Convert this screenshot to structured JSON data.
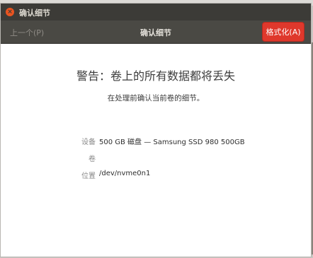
{
  "window": {
    "title": "确认细节",
    "close_icon": "close-icon"
  },
  "header": {
    "prev_label": "上一个(P)",
    "title": "确认细节",
    "format_label": "格式化(A)",
    "format_color": "#df382c"
  },
  "content": {
    "warning_title": "警告：卷上的所有数据都将丢失",
    "warning_subtitle": "在处理前确认当前卷的细节。",
    "details": [
      {
        "label": "设备",
        "value": "500 GB 磁盘 — Samsung SSD 980 500GB"
      },
      {
        "label": "卷",
        "value": ""
      },
      {
        "label": "位置",
        "value": "/dev/nvme0n1"
      }
    ]
  }
}
